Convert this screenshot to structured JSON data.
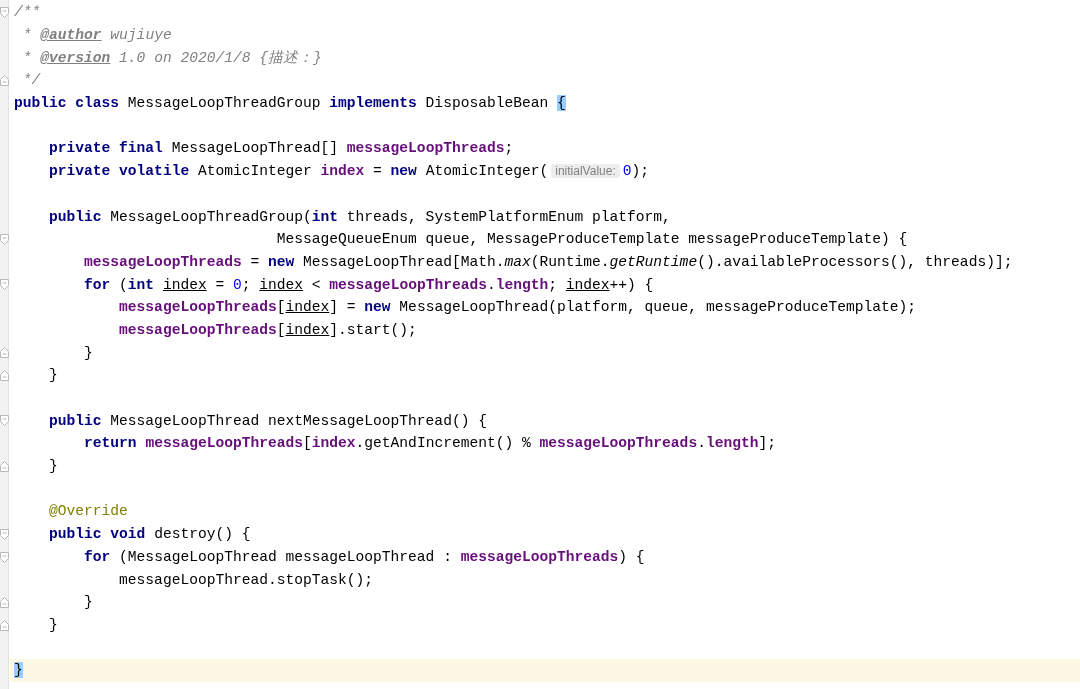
{
  "editor": {
    "blocks": [
      {
        "lines": [
          {
            "fold_open": true,
            "tokens": [
              {
                "kind": "comment",
                "text": "/**"
              }
            ]
          },
          {
            "tokens": [
              {
                "kind": "comment",
                "text": " * "
              },
              {
                "kind": "doctag",
                "text": "@author"
              },
              {
                "kind": "comment",
                "text": " wujiuye"
              }
            ]
          },
          {
            "tokens": [
              {
                "kind": "comment",
                "text": " * "
              },
              {
                "kind": "doctag",
                "text": "@version"
              },
              {
                "kind": "comment",
                "text": " 1.0 on 2020/1/8 {描述：}"
              }
            ]
          },
          {
            "fold_close": true,
            "tokens": [
              {
                "kind": "comment",
                "text": " */"
              }
            ]
          },
          {
            "tokens": [
              {
                "kind": "kw",
                "text": "public class"
              },
              {
                "kind": "plain",
                "text": " MessageLoopThreadGroup "
              },
              {
                "kind": "kw",
                "text": "implements"
              },
              {
                "kind": "plain",
                "text": " DisposableBean "
              },
              {
                "kind": "match",
                "text": "{"
              }
            ]
          }
        ]
      },
      {
        "lines": [
          {
            "tokens": [
              {
                "kind": "kw",
                "text": "    private final"
              },
              {
                "kind": "plain",
                "text": " MessageLoopThread[] "
              },
              {
                "kind": "field",
                "text": "messageLoopThreads"
              },
              {
                "kind": "plain",
                "text": ";"
              }
            ]
          },
          {
            "tokens": [
              {
                "kind": "kw",
                "text": "    private volatile"
              },
              {
                "kind": "plain",
                "text": " AtomicInteger "
              },
              {
                "kind": "field",
                "text": "index"
              },
              {
                "kind": "plain",
                "text": " = "
              },
              {
                "kind": "kw",
                "text": "new"
              },
              {
                "kind": "plain",
                "text": " AtomicInteger("
              },
              {
                "kind": "hint",
                "text": "initialValue:"
              },
              {
                "kind": "num",
                "text": "0"
              },
              {
                "kind": "plain",
                "text": ");"
              }
            ]
          }
        ]
      },
      {
        "lines": [
          {
            "tokens": [
              {
                "kind": "kw",
                "text": "    public"
              },
              {
                "kind": "plain",
                "text": " MessageLoopThreadGroup("
              },
              {
                "kind": "kw",
                "text": "int"
              },
              {
                "kind": "plain",
                "text": " threads, SystemPlatformEnum platform,"
              }
            ]
          },
          {
            "fold_open": true,
            "tokens": [
              {
                "kind": "plain",
                "text": "                              MessageQueueEnum queue, MessageProduceTemplate messageProduceTemplate) {"
              }
            ]
          },
          {
            "tokens": [
              {
                "kind": "field",
                "text": "        messageLoopThreads"
              },
              {
                "kind": "plain",
                "text": " = "
              },
              {
                "kind": "kw",
                "text": "new"
              },
              {
                "kind": "plain",
                "text": " MessageLoopThread[Math."
              },
              {
                "kind": "static",
                "text": "max"
              },
              {
                "kind": "plain",
                "text": "(Runtime."
              },
              {
                "kind": "static",
                "text": "getRuntime"
              },
              {
                "kind": "plain",
                "text": "().availableProcessors(), threads)];"
              }
            ]
          },
          {
            "fold_open": true,
            "tokens": [
              {
                "kind": "kw",
                "text": "        for"
              },
              {
                "kind": "plain",
                "text": " ("
              },
              {
                "kind": "kw",
                "text": "int "
              },
              {
                "kind": "local",
                "text": "index"
              },
              {
                "kind": "plain",
                "text": " = "
              },
              {
                "kind": "num",
                "text": "0"
              },
              {
                "kind": "plain",
                "text": "; "
              },
              {
                "kind": "local",
                "text": "index"
              },
              {
                "kind": "plain",
                "text": " < "
              },
              {
                "kind": "field",
                "text": "messageLoopThreads"
              },
              {
                "kind": "plain",
                "text": "."
              },
              {
                "kind": "field",
                "text": "length"
              },
              {
                "kind": "plain",
                "text": "; "
              },
              {
                "kind": "local",
                "text": "index"
              },
              {
                "kind": "plain",
                "text": "++) {"
              }
            ]
          },
          {
            "tokens": [
              {
                "kind": "field",
                "text": "            messageLoopThreads"
              },
              {
                "kind": "plain",
                "text": "["
              },
              {
                "kind": "local",
                "text": "index"
              },
              {
                "kind": "plain",
                "text": "] = "
              },
              {
                "kind": "kw",
                "text": "new"
              },
              {
                "kind": "plain",
                "text": " MessageLoopThread(platform, queue, messageProduceTemplate);"
              }
            ]
          },
          {
            "tokens": [
              {
                "kind": "field",
                "text": "            messageLoopThreads"
              },
              {
                "kind": "plain",
                "text": "["
              },
              {
                "kind": "local",
                "text": "index"
              },
              {
                "kind": "plain",
                "text": "].start();"
              }
            ]
          },
          {
            "fold_close": true,
            "tokens": [
              {
                "kind": "plain",
                "text": "        }"
              }
            ]
          },
          {
            "fold_close": true,
            "tokens": [
              {
                "kind": "plain",
                "text": "    }"
              }
            ]
          }
        ]
      },
      {
        "lines": [
          {
            "fold_open": true,
            "tokens": [
              {
                "kind": "kw",
                "text": "    public"
              },
              {
                "kind": "plain",
                "text": " MessageLoopThread nextMessageLoopThread() {"
              }
            ]
          },
          {
            "tokens": [
              {
                "kind": "kw",
                "text": "        return "
              },
              {
                "kind": "field",
                "text": "messageLoopThreads"
              },
              {
                "kind": "plain",
                "text": "["
              },
              {
                "kind": "field",
                "text": "index"
              },
              {
                "kind": "plain",
                "text": ".getAndIncrement() % "
              },
              {
                "kind": "field",
                "text": "messageLoopThreads"
              },
              {
                "kind": "plain",
                "text": "."
              },
              {
                "kind": "field",
                "text": "length"
              },
              {
                "kind": "plain",
                "text": "];"
              }
            ]
          },
          {
            "fold_close": true,
            "tokens": [
              {
                "kind": "plain",
                "text": "    }"
              }
            ]
          }
        ]
      },
      {
        "lines": [
          {
            "tokens": [
              {
                "kind": "ann",
                "text": "    @Override"
              }
            ]
          },
          {
            "fold_open": true,
            "tokens": [
              {
                "kind": "kw",
                "text": "    public void"
              },
              {
                "kind": "plain",
                "text": " destroy() {"
              }
            ]
          },
          {
            "fold_open": true,
            "tokens": [
              {
                "kind": "kw",
                "text": "        for"
              },
              {
                "kind": "plain",
                "text": " (MessageLoopThread messageLoopThread : "
              },
              {
                "kind": "field",
                "text": "messageLoopThreads"
              },
              {
                "kind": "plain",
                "text": ") {"
              }
            ]
          },
          {
            "tokens": [
              {
                "kind": "plain",
                "text": "            messageLoopThread.stopTask();"
              }
            ]
          },
          {
            "fold_close": true,
            "tokens": [
              {
                "kind": "plain",
                "text": "        }"
              }
            ]
          },
          {
            "fold_close": true,
            "tokens": [
              {
                "kind": "plain",
                "text": "    }"
              }
            ]
          }
        ]
      },
      {
        "lines": [
          {
            "current": true,
            "tokens": [
              {
                "kind": "match",
                "text": "}"
              }
            ]
          }
        ]
      }
    ]
  }
}
